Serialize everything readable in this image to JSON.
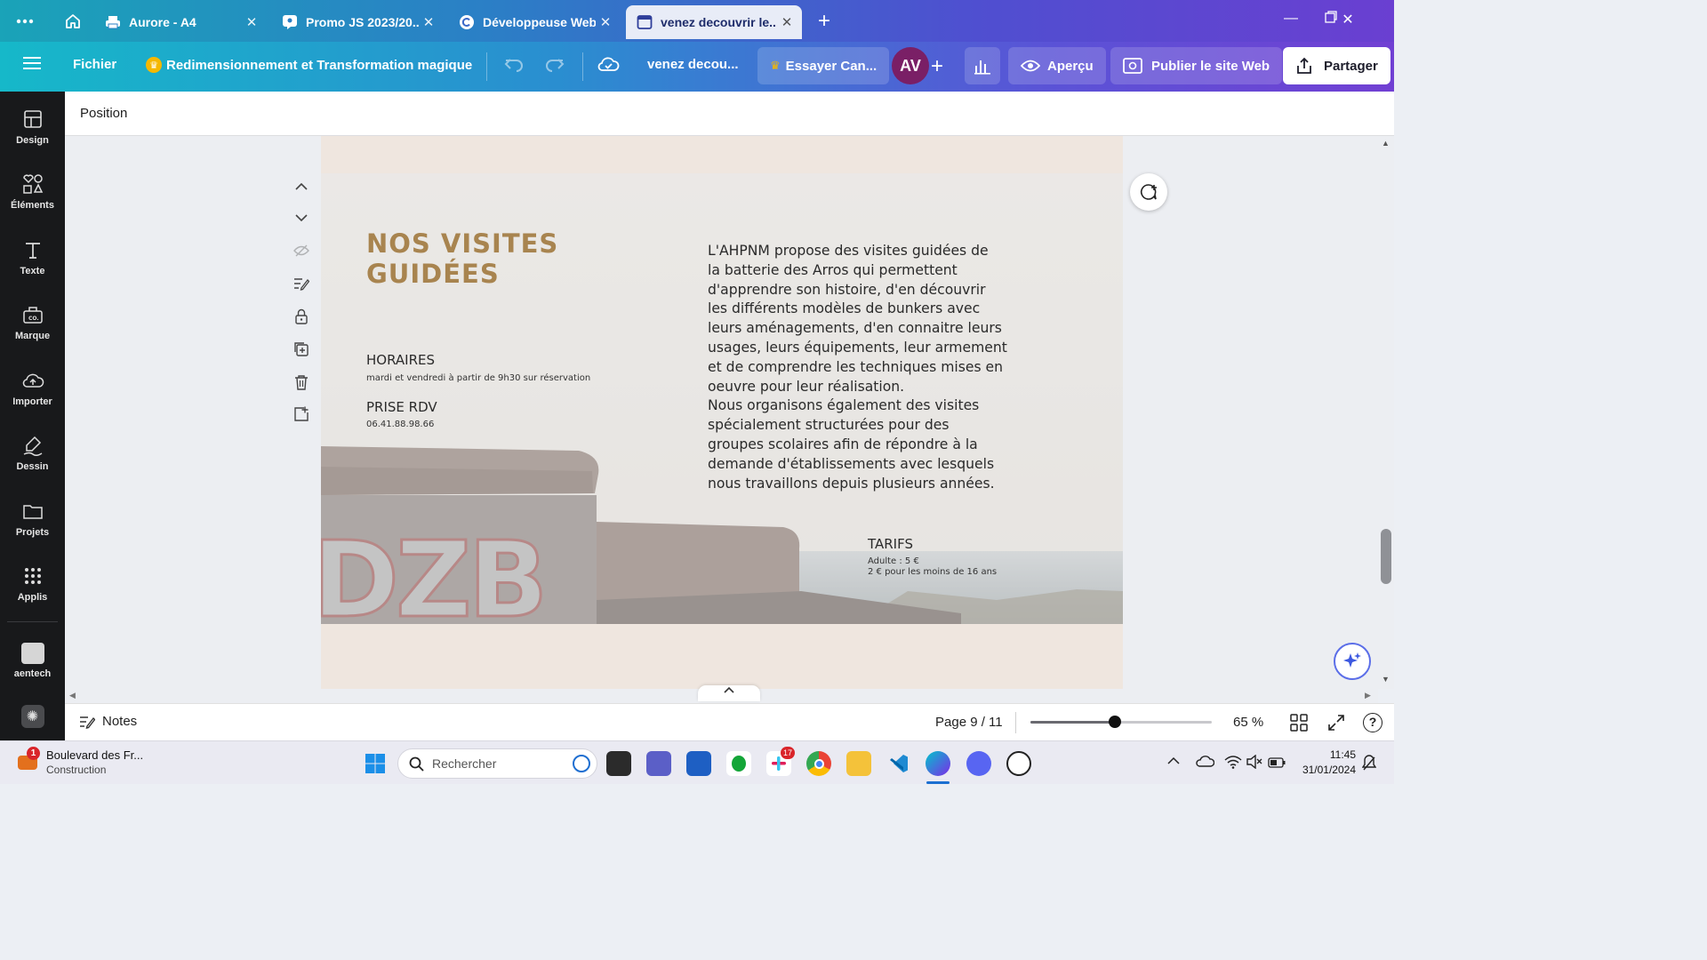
{
  "browser": {
    "tabs": [
      {
        "title": "Aurore - A4",
        "icon": "printer-icon",
        "active": false
      },
      {
        "title": "Promo JS 2023/20...",
        "icon": "teams-icon",
        "active": false
      },
      {
        "title": "Développeuse Web...",
        "icon": "canva-c-icon",
        "active": false
      },
      {
        "title": "venez decouvrir le...",
        "icon": "page-icon",
        "active": true
      }
    ],
    "new_tab": "+"
  },
  "header": {
    "file_label": "Fichier",
    "magic_label": "Redimensionnement et Transformation magique",
    "doc_title": "venez decou...",
    "try_label": "Essayer Can...",
    "avatar_initials": "AV",
    "preview_label": "Aperçu",
    "publish_label": "Publier le site Web",
    "share_label": "Partager"
  },
  "sidebar": {
    "items": [
      {
        "label": "Design",
        "icon": "layout-icon"
      },
      {
        "label": "Éléments",
        "icon": "shapes-icon"
      },
      {
        "label": "Texte",
        "icon": "text-icon"
      },
      {
        "label": "Marque",
        "icon": "brand-icon"
      },
      {
        "label": "Importer",
        "icon": "upload-icon"
      },
      {
        "label": "Dessin",
        "icon": "draw-icon"
      },
      {
        "label": "Projets",
        "icon": "folder-icon"
      },
      {
        "label": "Applis",
        "icon": "apps-icon"
      }
    ],
    "team_label": "aentech"
  },
  "context_toolbar": {
    "position_label": "Position"
  },
  "page": {
    "title_line1": "NOS VISITES",
    "title_line2": "GUIDÉES",
    "horaires_label": "HORAIRES",
    "horaires_text": "mardi et vendredi à partir de 9h30 sur réservation",
    "rdv_label": "PRISE RDV",
    "rdv_phone": "06.41.88.98.66",
    "paragraph": [
      "L'AHPNM propose des visites guidées de",
      "la batterie des Arros qui permettent",
      "d'apprendre son histoire, d'en découvrir",
      "les différents modèles de bunkers avec",
      "leurs aménagements, d'en connaitre leurs",
      "usages, leurs équipements, leur armement",
      "et de comprendre les techniques mises en",
      "oeuvre pour leur réalisation.",
      "Nous organisons également des visites",
      "spécialement structurées pour des",
      "groupes scolaires afin de répondre à la",
      "demande d'établissements avec lesquels",
      "nous travaillons depuis plusieurs années."
    ],
    "tarifs_label": "TARIFS",
    "tarif_adult": "Adulte : 5 €",
    "tarif_child": "2 € pour les moins de 16 ans",
    "graffiti_text": "DZB"
  },
  "footer": {
    "notes_label": "Notes",
    "page_indicator": "Page 9 / 11",
    "zoom_label": "65 %",
    "zoom_value": 0.65
  },
  "taskbar": {
    "weather_title": "Boulevard des Fr...",
    "weather_sub": "Construction",
    "weather_badge": "1",
    "search_placeholder": "Rechercher",
    "slack_badge": "17",
    "time": "11:45",
    "date": "31/01/2024"
  },
  "colors": {
    "title_gold": "#a8844f",
    "avatar": "#7a1f66",
    "sidebar_bg": "#18191b"
  }
}
